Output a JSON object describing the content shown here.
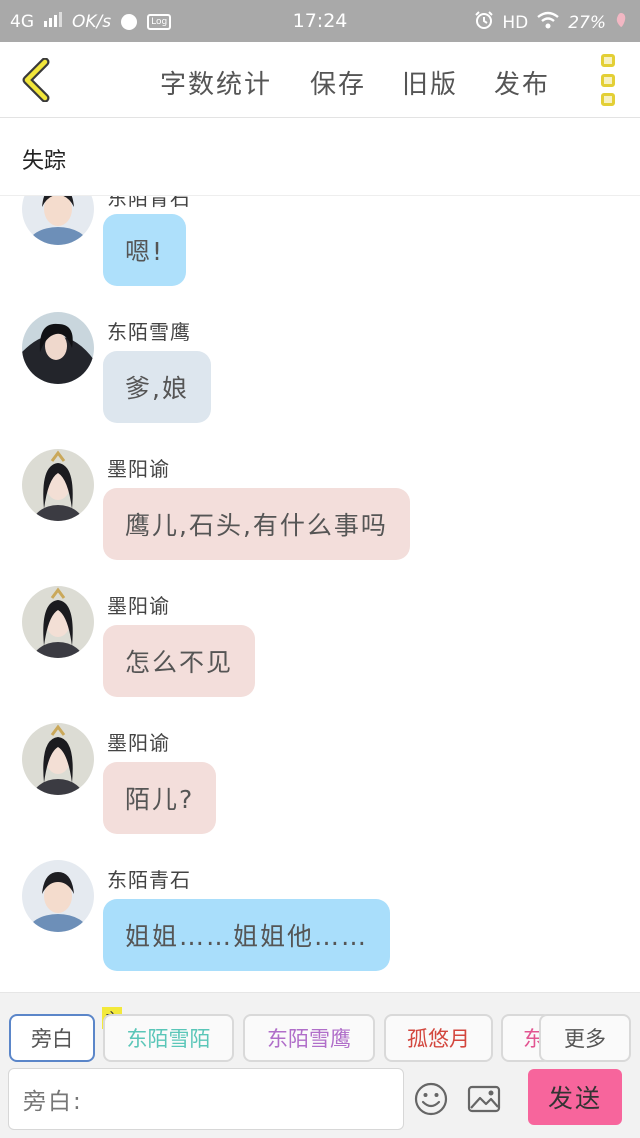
{
  "status_bar": {
    "network": "4G",
    "speed": "OK/s",
    "time": "17:24",
    "hd": "HD",
    "battery": "27%"
  },
  "toolbar": {
    "word_count": "字数统计",
    "save": "保存",
    "old_version": "旧版",
    "publish": "发布"
  },
  "chapter": {
    "title": "失踪"
  },
  "messages": [
    {
      "sender": "东陌青石",
      "text": "嗯!",
      "bubble_color": "#aee0fb",
      "avatar": "boy-avatar"
    },
    {
      "sender": "东陌雪鹰",
      "text": "爹,娘",
      "bubble_color": "#dde6ee",
      "avatar": "dark-hair-avatar"
    },
    {
      "sender": "墨阳谕",
      "text": "鹰儿,石头,有什么事吗",
      "bubble_color": "#f3dedb",
      "avatar": "woman-avatar"
    },
    {
      "sender": "墨阳谕",
      "text": "怎么不见",
      "bubble_color": "#f3dedb",
      "avatar": "woman-avatar"
    },
    {
      "sender": "墨阳谕",
      "text": "陌儿?",
      "bubble_color": "#f3dedb",
      "avatar": "woman-avatar"
    },
    {
      "sender": "东陌青石",
      "text": "姐姐……姐姐他……",
      "bubble_color": "#a9defb",
      "avatar": "boy-avatar"
    }
  ],
  "characters": {
    "narration": {
      "label": "旁白",
      "color": "#555555"
    },
    "host_badge": "主",
    "chip1": {
      "label": "东陌雪陌",
      "color": "#5ac6b8"
    },
    "chip2": {
      "label": "东陌雪鹰",
      "color": "#b06ec9"
    },
    "chip3": {
      "label": "孤悠月",
      "color": "#d3473e"
    },
    "chip4": {
      "label": "东",
      "color": "#e25591"
    },
    "more": {
      "label": "更多",
      "color": "#555555"
    }
  },
  "composer": {
    "placeholder": "旁白:",
    "send_label": "发送",
    "emoji_icon": "smile-icon",
    "image_icon": "image-icon"
  }
}
